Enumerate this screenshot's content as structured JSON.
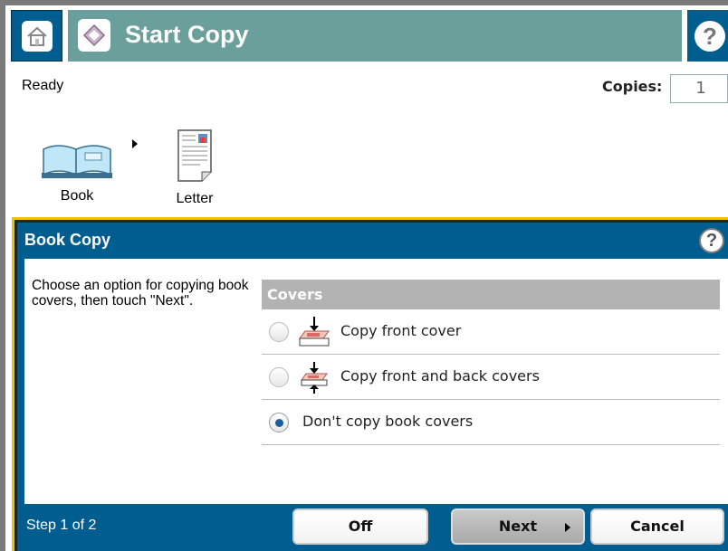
{
  "header": {
    "title": "Start Copy",
    "home_icon": "home-icon",
    "start_icon": "start-diamond-icon",
    "help_label": "?"
  },
  "status": {
    "text": "Ready",
    "copies_label": "Copies:",
    "copies_value": "1"
  },
  "flow": {
    "items": [
      {
        "label": "Book",
        "icon": "book-icon"
      },
      {
        "label": "Letter",
        "icon": "letter-page-icon"
      }
    ]
  },
  "dialog": {
    "title": "Book Copy",
    "help_label": "?",
    "instructions": "Choose an option for copying book covers, then touch \"Next\".",
    "group_label": "Covers",
    "options": [
      {
        "label": "Copy front cover",
        "icon": "front-cover-icon",
        "selected": false
      },
      {
        "label": "Copy front and back covers",
        "icon": "front-back-cover-icon",
        "selected": false
      },
      {
        "label": "Don't copy book covers",
        "selected": true
      }
    ],
    "step": "Step 1 of 2",
    "buttons": {
      "off": "Off",
      "next": "Next",
      "cancel": "Cancel"
    }
  },
  "colors": {
    "header_bg": "#6a9f9b",
    "accent_blue": "#005d8f",
    "dialog_border_yellow": "#e8c800",
    "group_header_gray": "#b3b3b3"
  }
}
